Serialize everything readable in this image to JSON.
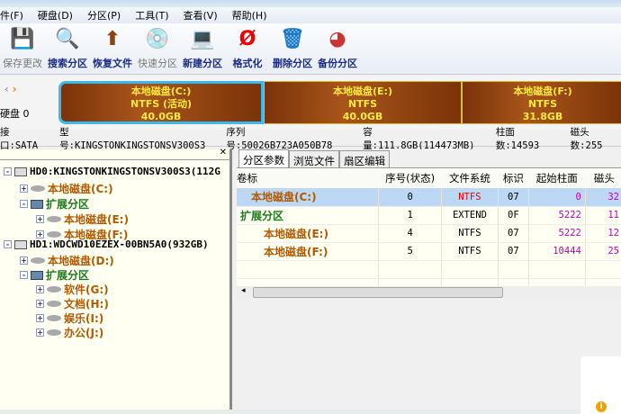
{
  "menu": [
    "件(F)",
    "硬盘(D)",
    "分区(P)",
    "工具(T)",
    "查看(V)",
    "帮助(H)"
  ],
  "toolbar": [
    {
      "label": "保存更改",
      "icon": "save-icon",
      "glyph": "💾",
      "enabled": false
    },
    {
      "label": "搜索分区",
      "icon": "search-icon",
      "glyph": "🔍",
      "enabled": true
    },
    {
      "label": "恢复文件",
      "icon": "recover-icon",
      "glyph": "⬆",
      "enabled": true
    },
    {
      "label": "快速分区",
      "icon": "quick-partition-icon",
      "glyph": "💿",
      "enabled": false
    },
    {
      "label": "新建分区",
      "icon": "new-partition-icon",
      "glyph": "💻",
      "enabled": true
    },
    {
      "label": "格式化",
      "icon": "format-icon",
      "glyph": "Ø",
      "enabled": true
    },
    {
      "label": "删除分区",
      "icon": "delete-icon",
      "glyph": "🗑",
      "enabled": true
    },
    {
      "label": "备份分区",
      "icon": "backup-icon",
      "glyph": "◕",
      "enabled": true
    }
  ],
  "disk_label": "硬盘 0",
  "partitions": [
    {
      "name": "本地磁盘(C:)",
      "fs": "NTFS (活动)",
      "size": "40.0GB"
    },
    {
      "name": "本地磁盘(E:)",
      "fs": "NTFS",
      "size": "40.0GB"
    },
    {
      "name": "本地磁盘(F:)",
      "fs": "NTFS",
      "size": "31.8GB"
    }
  ],
  "info": [
    "接口:SATA",
    "型号:KINGSTONKINGSTONSV300S3",
    "序列号:50026B723A050B78",
    "容量:111.8GB(114473MB)",
    "柱面数:14593",
    "磁头数:255"
  ],
  "tree": [
    {
      "label": "HD0:KINGSTONKINGSTONSV300S3(112G",
      "type": "hd",
      "pm": "-"
    },
    {
      "label": "本地磁盘(C:)",
      "type": "dk",
      "pm": "+"
    },
    {
      "label": "扩展分区",
      "type": "ex",
      "pm": "-"
    },
    {
      "label": "本地磁盘(E:)",
      "type": "dk",
      "pm": "+"
    },
    {
      "label": "本地磁盘(F:)",
      "type": "dk",
      "pm": "+"
    },
    {
      "label": "HD1:WDCWD10EZEX-00BN5A0(932GB)",
      "type": "hd",
      "pm": "-"
    },
    {
      "label": "本地磁盘(D:)",
      "type": "dk",
      "pm": "+"
    },
    {
      "label": "扩展分区",
      "type": "ex",
      "pm": "-"
    },
    {
      "label": "软件(G:)",
      "type": "dk",
      "pm": "+"
    },
    {
      "label": "文档(H:)",
      "type": "dk",
      "pm": "+"
    },
    {
      "label": "娱乐(I:)",
      "type": "dk",
      "pm": "+"
    },
    {
      "label": "办公(J:)",
      "type": "dk",
      "pm": "+"
    }
  ],
  "tabs": [
    "分区参数",
    "浏览文件",
    "扇区编辑"
  ],
  "columns": [
    "卷标",
    "序号(状态)",
    "文件系统",
    "标识",
    "起始柱面",
    "磁头"
  ],
  "rows": [
    [
      "本地磁盘(C:)",
      "0",
      "NTFS",
      "07",
      "0",
      "32"
    ],
    [
      "扩展分区",
      "1",
      "EXTEND",
      "0F",
      "5222",
      "11"
    ],
    [
      "本地磁盘(E:)",
      "4",
      "NTFS",
      "07",
      "5222",
      "12"
    ],
    [
      "本地磁盘(F:)",
      "5",
      "NTFS",
      "07",
      "10444",
      "25"
    ]
  ]
}
